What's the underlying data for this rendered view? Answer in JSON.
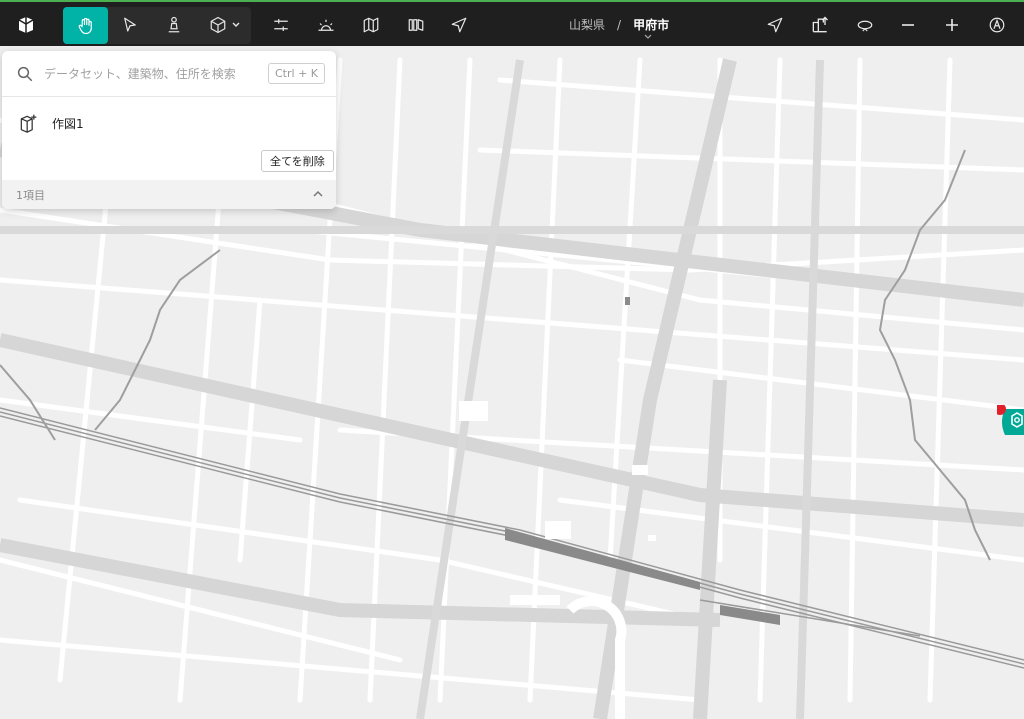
{
  "toolbar": {
    "tools": [
      {
        "name": "hand-tool",
        "icon": "hand-icon",
        "active": true
      },
      {
        "name": "select-tool",
        "icon": "cursor-icon",
        "active": false
      },
      {
        "name": "pedestrian-tool",
        "icon": "pedestrian-icon",
        "active": false
      },
      {
        "name": "object-tool",
        "icon": "cube-icon",
        "active": false
      }
    ],
    "right_tools": [
      "settings-sliders-icon",
      "sunrise-icon",
      "map-icon",
      "layers-icon",
      "send-icon"
    ]
  },
  "breadcrumb": {
    "prefecture": "山梨県",
    "separator": "/",
    "city": "甲府市"
  },
  "panel": {
    "search_placeholder": "データセット、建築物、住所を検索",
    "shortcut": "Ctrl + K",
    "items": [
      {
        "label": "作図1",
        "icon": "building-add-icon"
      }
    ],
    "delete_all_label": "全てを削除",
    "count_label": "1項目"
  },
  "map": {
    "marker_color": "#e3202a",
    "marker_badge_color": "#00a896"
  },
  "colors": {
    "accent": "#00b3a6",
    "toolbar_bg": "#1f1f1f",
    "road": "#ffffff",
    "land": "#efefef"
  }
}
